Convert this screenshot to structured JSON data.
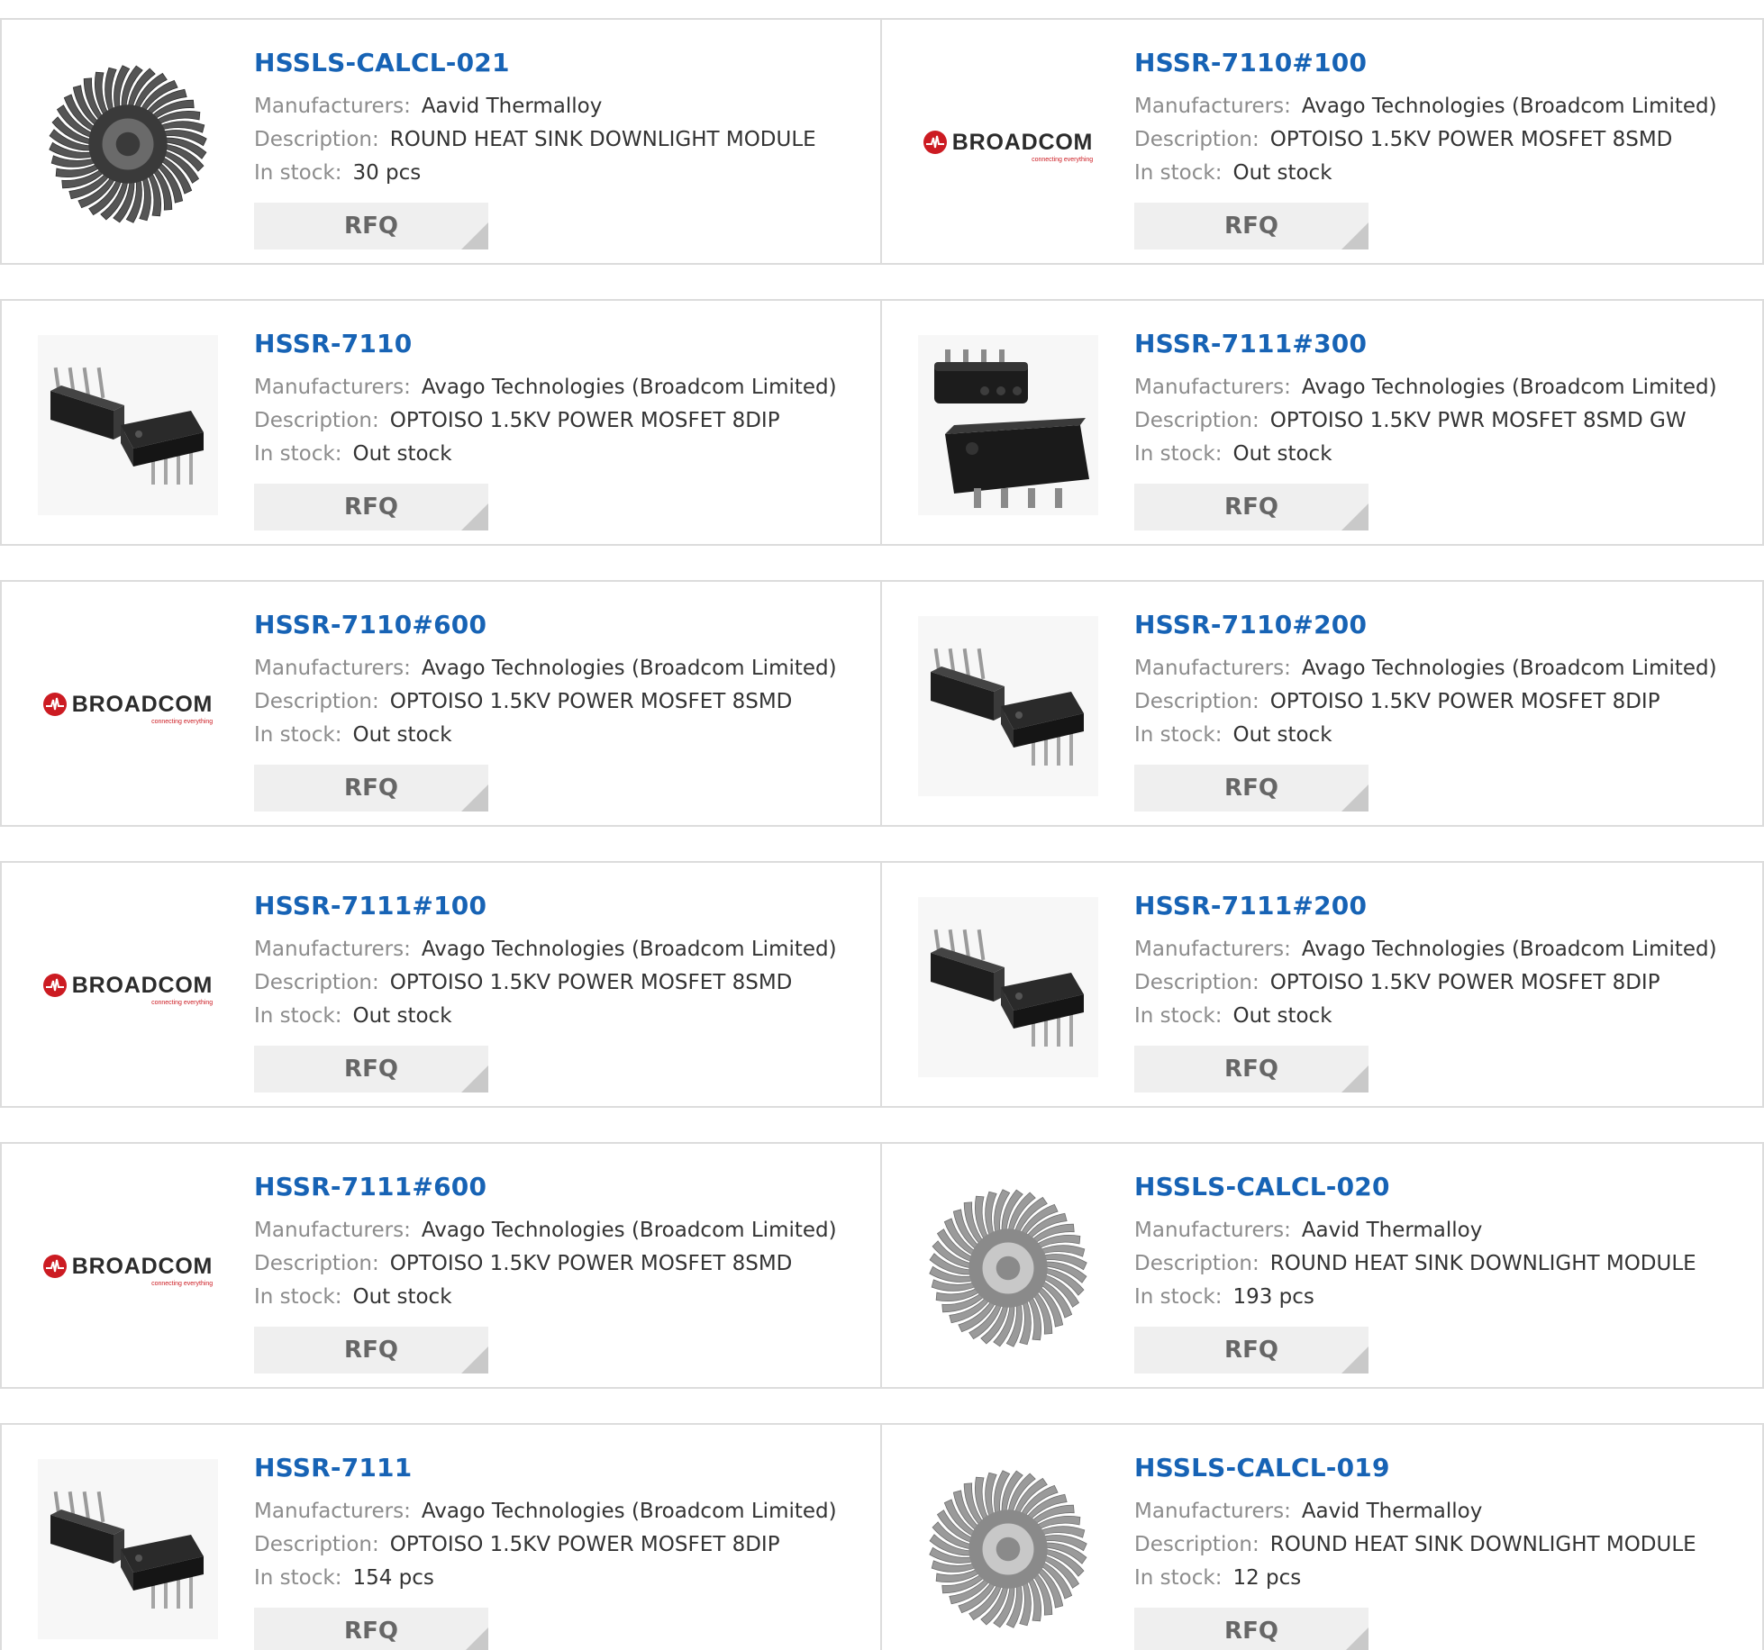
{
  "labels": {
    "manufacturers": "Manufacturers:",
    "description": "Description:",
    "in_stock": "In stock:",
    "rfq": "RFQ"
  },
  "products": [
    {
      "part": "HSSLS-CALCL-021",
      "manufacturer": "Aavid Thermalloy",
      "description": "ROUND HEAT SINK DOWNLIGHT MODULE",
      "stock": "30 pcs",
      "image": "heatsink-dark-icon"
    },
    {
      "part": "HSSR-7110#100",
      "manufacturer": "Avago Technologies (Broadcom Limited)",
      "description": "OPTOISO 1.5KV POWER MOSFET 8SMD",
      "stock": "Out stock",
      "image": "broadcom-logo"
    },
    {
      "part": "HSSR-7110",
      "manufacturer": "Avago Technologies (Broadcom Limited)",
      "description": "OPTOISO 1.5KV POWER MOSFET 8DIP",
      "stock": "Out stock",
      "image": "dip-chip-icon"
    },
    {
      "part": "HSSR-7111#300",
      "manufacturer": "Avago Technologies (Broadcom Limited)",
      "description": "OPTOISO 1.5KV PWR MOSFET 8SMD GW",
      "stock": "Out stock",
      "image": "smd-chip-icon"
    },
    {
      "part": "HSSR-7110#600",
      "manufacturer": "Avago Technologies (Broadcom Limited)",
      "description": "OPTOISO 1.5KV POWER MOSFET 8SMD",
      "stock": "Out stock",
      "image": "broadcom-logo"
    },
    {
      "part": "HSSR-7110#200",
      "manufacturer": "Avago Technologies (Broadcom Limited)",
      "description": "OPTOISO 1.5KV POWER MOSFET 8DIP",
      "stock": "Out stock",
      "image": "dip-chip-icon"
    },
    {
      "part": "HSSR-7111#100",
      "manufacturer": "Avago Technologies (Broadcom Limited)",
      "description": "OPTOISO 1.5KV POWER MOSFET 8SMD",
      "stock": "Out stock",
      "image": "broadcom-logo"
    },
    {
      "part": "HSSR-7111#200",
      "manufacturer": "Avago Technologies (Broadcom Limited)",
      "description": "OPTOISO 1.5KV POWER MOSFET 8DIP",
      "stock": "Out stock",
      "image": "dip-chip-icon"
    },
    {
      "part": "HSSR-7111#600",
      "manufacturer": "Avago Technologies (Broadcom Limited)",
      "description": "OPTOISO 1.5KV POWER MOSFET 8SMD",
      "stock": "Out stock",
      "image": "broadcom-logo"
    },
    {
      "part": "HSSLS-CALCL-020",
      "manufacturer": "Aavid Thermalloy",
      "description": "ROUND HEAT SINK DOWNLIGHT MODULE",
      "stock": "193 pcs",
      "image": "heatsink-light-icon"
    },
    {
      "part": "HSSR-7111",
      "manufacturer": "Avago Technologies (Broadcom Limited)",
      "description": "OPTOISO 1.5KV POWER MOSFET 8DIP",
      "stock": "154 pcs",
      "image": "dip-chip-icon"
    },
    {
      "part": "HSSLS-CALCL-019",
      "manufacturer": "Aavid Thermalloy",
      "description": "ROUND HEAT SINK DOWNLIGHT MODULE",
      "stock": "12 pcs",
      "image": "heatsink-light-icon"
    }
  ],
  "broadcom": {
    "name": "BROADCOM",
    "tagline": "connecting everything"
  },
  "colors": {
    "part_link": "#1763b5",
    "label": "#8c8c8c",
    "border": "#dcdcdc",
    "rfq_bg": "#efefef",
    "broadcom_red": "#cc1b22"
  }
}
